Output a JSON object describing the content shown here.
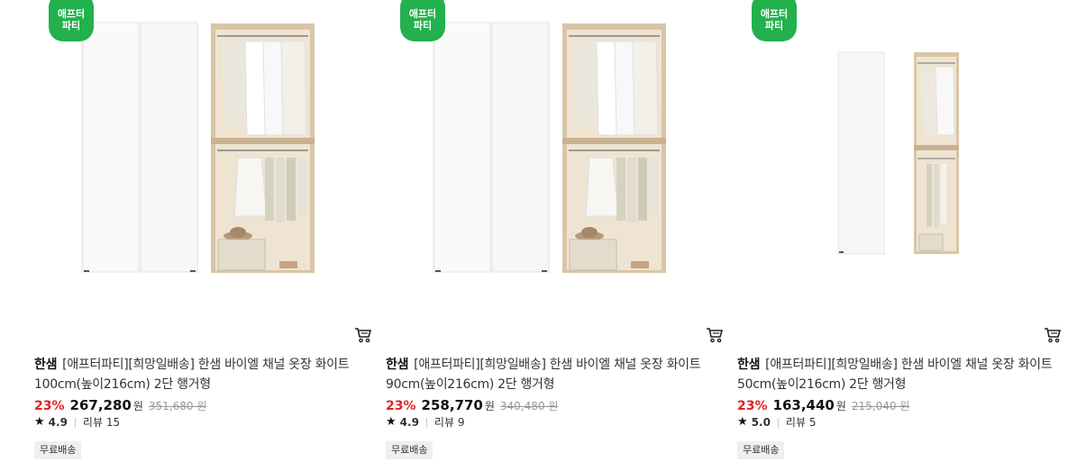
{
  "products": [
    {
      "badge_line1": "애프터",
      "badge_line2": "파티",
      "brand": "한샘",
      "name": "[애프터파티][희망일배송] 한샘 바이엘 채널 옷장 화이트 100cm(높이216cm) 2단 행거형",
      "discount": "23%",
      "price": "267,280",
      "currency": "원",
      "original_price": "351,680 원",
      "rating": "4.9",
      "reviews": "리뷰 15",
      "shipping": "무료배송"
    },
    {
      "badge_line1": "애프터",
      "badge_line2": "파티",
      "brand": "한샘",
      "name": "[애프터파티][희망일배송] 한샘 바이엘 채널 옷장 화이트 90cm(높이216cm) 2단 행거형",
      "discount": "23%",
      "price": "258,770",
      "currency": "원",
      "original_price": "340,480 원",
      "rating": "4.9",
      "reviews": "리뷰 9",
      "shipping": "무료배송"
    },
    {
      "badge_line1": "애프터",
      "badge_line2": "파티",
      "brand": "한샘",
      "name": "[애프터파티][희망일배송] 한샘 바이엘 채널 옷장 화이트 50cm(높이216cm) 2단 행거형",
      "discount": "23%",
      "price": "163,440",
      "currency": "원",
      "original_price": "215,040 원",
      "rating": "5.0",
      "reviews": "리뷰 5",
      "shipping": "무료배송"
    }
  ],
  "icons": {
    "cart": "cart-icon",
    "star": "star-icon"
  },
  "colors": {
    "badge": "#22b14c",
    "discount": "#e32020"
  }
}
